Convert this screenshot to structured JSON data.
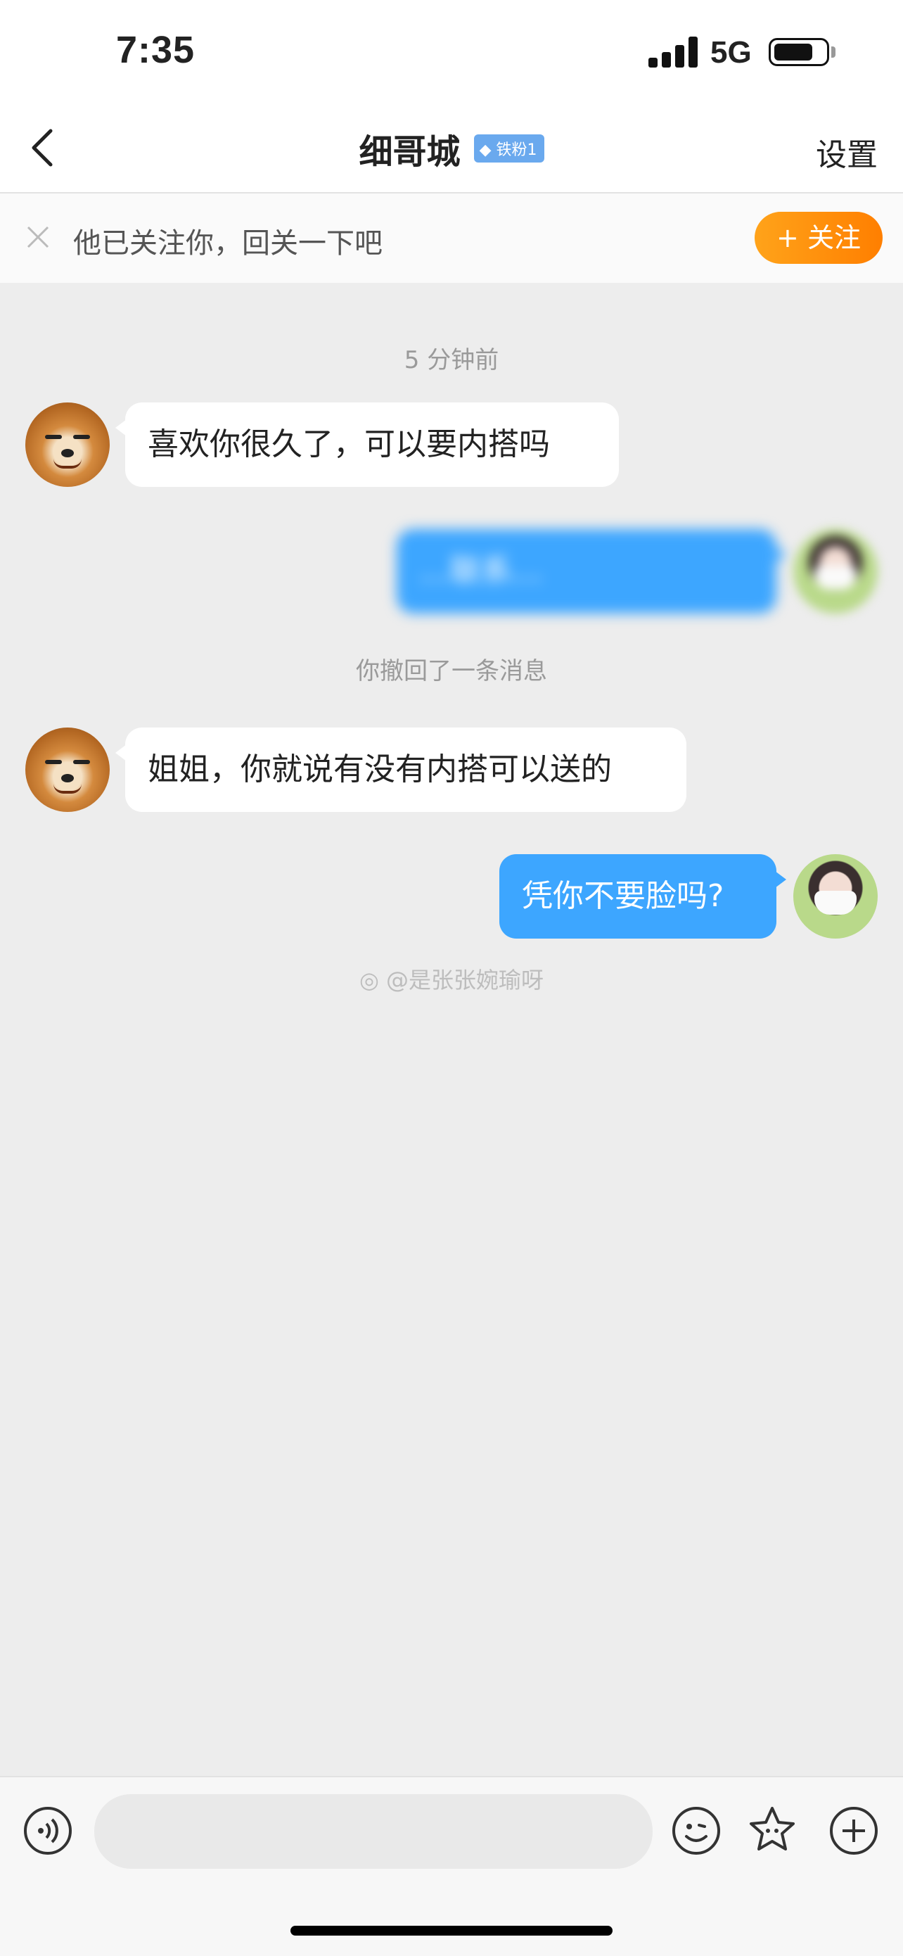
{
  "status_bar": {
    "time": "7:35",
    "network": "5G"
  },
  "nav": {
    "title": "细哥城",
    "badge": "铁粉1",
    "settings": "设置"
  },
  "follow_bar": {
    "text": "他已关注你，回关一下吧",
    "button": "+ 关注"
  },
  "chat": {
    "time_label": "5 分钟前",
    "messages": [
      {
        "side": "in",
        "text": "喜欢你很久了，可以要内搭吗"
      },
      {
        "side": "out",
        "text": "…联系…",
        "blurred": true
      },
      {
        "side": "system",
        "text": "你撤回了一条消息"
      },
      {
        "side": "in",
        "text": "姐姐，你就说有没有内搭可以送的"
      },
      {
        "side": "out",
        "text": "凭你不要脸吗?"
      }
    ],
    "watermark": "@是张张婉瑜呀"
  },
  "input": {
    "placeholder": ""
  }
}
